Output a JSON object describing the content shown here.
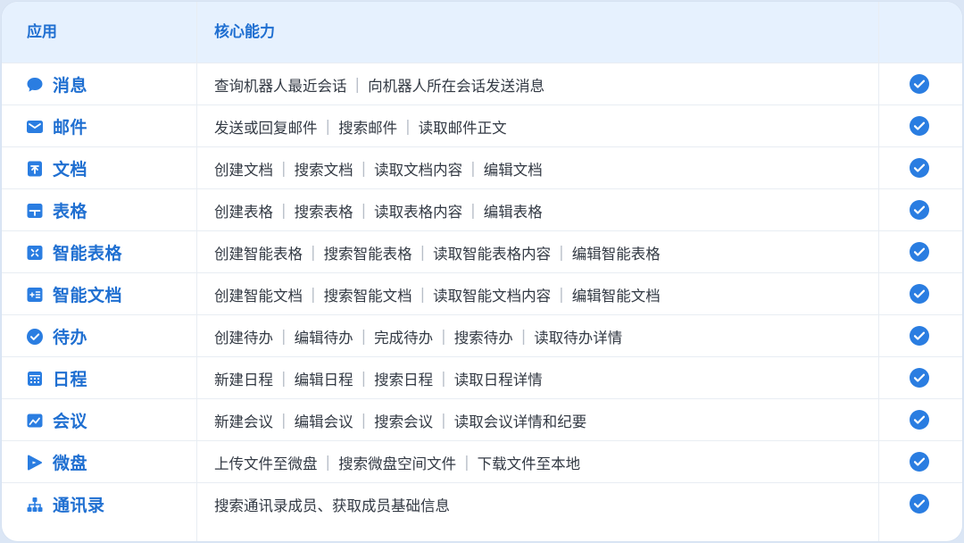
{
  "header": {
    "col_app": "应用",
    "col_capability": "核心能力"
  },
  "colors": {
    "accent": "#1f6fd1",
    "header_bg": "#e6f1fe",
    "check": "#2a7de1"
  },
  "rows": [
    {
      "icon": "chat-bubble-icon",
      "app": "消息",
      "caps": [
        "查询机器人最近会话",
        "向机器人所在会话发送消息"
      ],
      "supported": true
    },
    {
      "icon": "mail-icon",
      "app": "邮件",
      "caps": [
        "发送或回复邮件",
        "搜索邮件",
        "读取邮件正文"
      ],
      "supported": true
    },
    {
      "icon": "document-icon",
      "app": "文档",
      "caps": [
        "创建文档",
        "搜索文档",
        "读取文档内容",
        "编辑文档"
      ],
      "supported": true
    },
    {
      "icon": "table-icon",
      "app": "表格",
      "caps": [
        "创建表格",
        "搜索表格",
        "读取表格内容",
        "编辑表格"
      ],
      "supported": true
    },
    {
      "icon": "smart-table-icon",
      "app": "智能表格",
      "caps": [
        "创建智能表格",
        "搜索智能表格",
        "读取智能表格内容",
        "编辑智能表格"
      ],
      "supported": true
    },
    {
      "icon": "smart-document-icon",
      "app": "智能文档",
      "caps": [
        "创建智能文档",
        "搜索智能文档",
        "读取智能文档内容",
        "编辑智能文档"
      ],
      "supported": true
    },
    {
      "icon": "todo-check-icon",
      "app": "待办",
      "caps": [
        "创建待办",
        "编辑待办",
        "完成待办",
        "搜索待办",
        "读取待办详情"
      ],
      "supported": true
    },
    {
      "icon": "calendar-icon",
      "app": "日程",
      "caps": [
        "新建日程",
        "编辑日程",
        "搜索日程",
        "读取日程详情"
      ],
      "supported": true
    },
    {
      "icon": "meeting-icon",
      "app": "会议",
      "caps": [
        "新建会议",
        "编辑会议",
        "搜索会议",
        "读取会议详情和纪要"
      ],
      "supported": true
    },
    {
      "icon": "drive-icon",
      "app": "微盘",
      "caps": [
        "上传文件至微盘",
        "搜索微盘空间文件",
        "下载文件至本地"
      ],
      "supported": true
    },
    {
      "icon": "contacts-icon",
      "app": "通讯录",
      "caps": [
        "搜索通讯录成员、获取成员基础信息"
      ],
      "supported": true
    }
  ]
}
